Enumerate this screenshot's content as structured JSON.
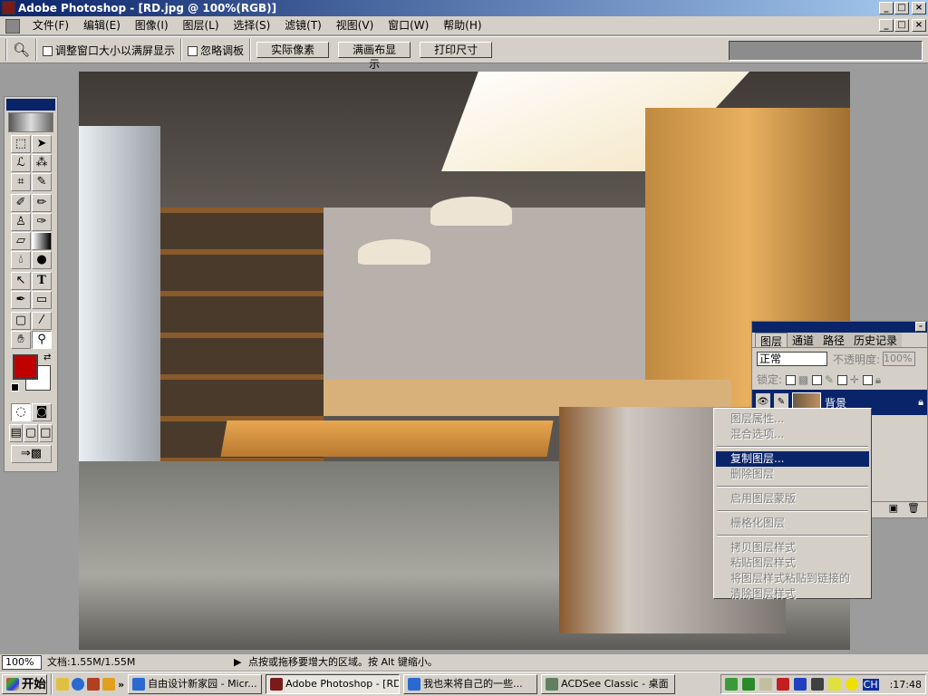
{
  "window": {
    "title": "Adobe Photoshop - [RD.jpg @ 100%(RGB)]"
  },
  "menu": [
    "文件(F)",
    "编辑(E)",
    "图像(I)",
    "图层(L)",
    "选择(S)",
    "滤镜(T)",
    "视图(V)",
    "窗口(W)",
    "帮助(H)"
  ],
  "options": {
    "resize_label": "调整窗口大小以满屏显示",
    "ignore_palettes_label": "忽略调板",
    "actual_pixels": "实际像素",
    "fit_screen": "满画布显示",
    "print_size": "打印尺寸"
  },
  "tools": [
    "marquee",
    "move",
    "lasso",
    "magic-wand",
    "crop",
    "slice",
    "healing-brush",
    "brush",
    "stamp",
    "history-brush",
    "eraser",
    "gradient",
    "blur",
    "dodge",
    "path-select",
    "type",
    "pen",
    "rectangle",
    "notes",
    "eyedropper",
    "hand",
    "zoom"
  ],
  "colors": {
    "foreground": "#c00000",
    "background": "#ffffff",
    "highlight": "#0a246a"
  },
  "layers_panel": {
    "tabs": [
      "图层",
      "通道",
      "路径",
      "历史记录"
    ],
    "blend_mode": "正常",
    "opacity_label": "不透明度:",
    "opacity": "100%",
    "lock_label": "锁定:",
    "layer_name": "背景"
  },
  "context_menu": {
    "groups": [
      [
        "图层属性...",
        "混合选项..."
      ],
      [
        "复制图层...",
        "删除图层"
      ],
      [
        "启用图层蒙版"
      ],
      [
        "栅格化图层"
      ],
      [
        "拷贝图层样式",
        "粘贴图层样式",
        "将图层样式粘贴到链接的",
        "清除图层样式"
      ]
    ],
    "highlighted": "复制图层..."
  },
  "status": {
    "zoom": "100%",
    "doc": "文档:1.55M/1.55M",
    "hint": "点按或拖移要增大的区域。按 Alt 键缩小。"
  },
  "taskbar": {
    "start": "开始",
    "tasks": [
      "自由设计新家园 - Micr...",
      "Adobe Photoshop - [RD...",
      "我也来将自己的一些...",
      "ACDSee Classic - 桌面"
    ],
    "tray_lang": "CH",
    "clock": ":17:48"
  }
}
